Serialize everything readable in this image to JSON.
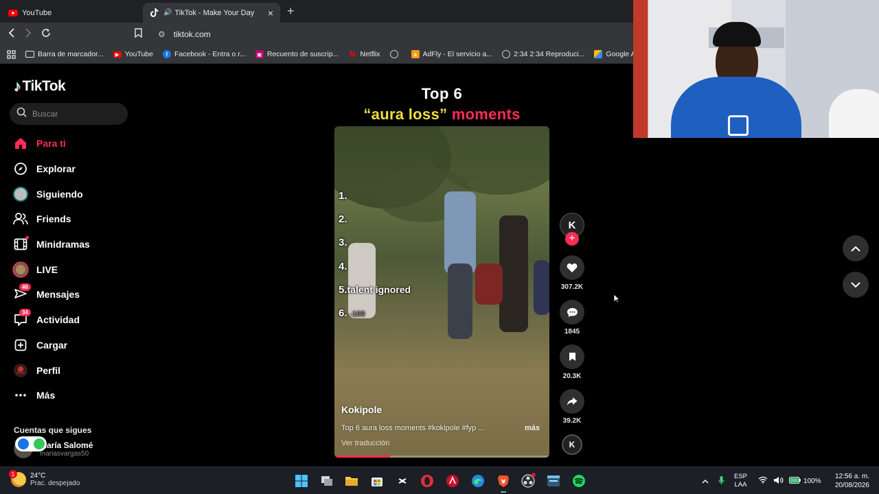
{
  "browser": {
    "tabs": [
      {
        "title": "YouTube",
        "active": false
      },
      {
        "title": "TikTok - Make Your Day",
        "active": true
      }
    ],
    "url": "tiktok.com",
    "bookmarks": [
      "Barra de marcador...",
      "YouTube",
      "Facebook - Entra o r...",
      "Recuento de suscrip...",
      "Netflix",
      "",
      "AdFly - El servicio a...",
      "2:34 2:34 Reproduci...",
      "Google AdSe"
    ]
  },
  "tiktok": {
    "logo": "TikTok",
    "search_placeholder": "Buscar",
    "nav": [
      {
        "label": "Para ti",
        "icon": "home-icon",
        "active": true
      },
      {
        "label": "Explorar",
        "icon": "compass-icon"
      },
      {
        "label": "Siguiendo",
        "icon": "following-avatar-icon"
      },
      {
        "label": "Friends",
        "icon": "friends-icon"
      },
      {
        "label": "Minidramas",
        "icon": "film-icon"
      },
      {
        "label": "LIVE",
        "icon": "live-icon"
      },
      {
        "label": "Mensajes",
        "icon": "messages-icon",
        "badge": "46"
      },
      {
        "label": "Actividad",
        "icon": "activity-icon",
        "badge": "34"
      },
      {
        "label": "Cargar",
        "icon": "upload-icon"
      },
      {
        "label": "Perfil",
        "icon": "profile-avatar-icon"
      },
      {
        "label": "Más",
        "icon": "more-icon"
      }
    ],
    "following_heading": "Cuentas que sigues",
    "following_account": {
      "name": "María Salomé",
      "username": "mariasvargas50"
    },
    "video": {
      "title_line1": "Top 6",
      "title_part_yellow": "“aura loss”",
      "title_part_red": "moments",
      "ranks": [
        {
          "num": "1.",
          "text": ""
        },
        {
          "num": "2.",
          "text": ""
        },
        {
          "num": "3.",
          "text": ""
        },
        {
          "num": "4.",
          "text": ""
        },
        {
          "num": "5.",
          "text": "talent ignored"
        },
        {
          "num": "6.",
          "text": "-100"
        }
      ],
      "author": "Kokipole",
      "description": "Top 6 aura loss moments #kokipole #fyp ...",
      "more_label": "más",
      "translate_label": "Ver traducción",
      "progress": 0.26
    },
    "actions": {
      "creator_initial": "K",
      "likes": "307.2K",
      "comments": "1845",
      "saves": "20.3K",
      "shares": "39.2K"
    }
  },
  "taskbar": {
    "weather_temp": "24°C",
    "weather_desc": "Prac. despejado",
    "weather_badge": "1",
    "lang_top": "ESP",
    "lang_bottom": "LAA",
    "battery": "100%",
    "time": "12:56 a. m.",
    "date": "20/08/2026"
  },
  "colors": {
    "accent_red": "#fe2c55",
    "title_yellow": "#f2df3a",
    "tiktok_cyan": "#25f4ee"
  }
}
